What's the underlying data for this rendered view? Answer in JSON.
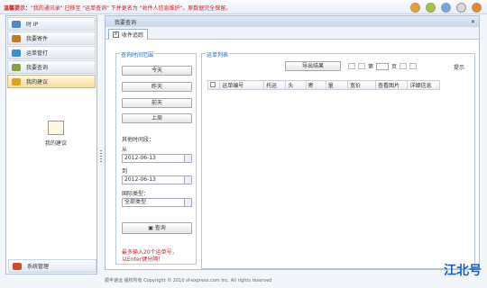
{
  "notice": {
    "prefix": "温馨提示：",
    "text": "\"我的通讯录\" 已移至 \"运单查询\" 下并更名为 \"收件人信息维护\"，原数据完全保留。"
  },
  "window_buttons": [
    "#f0a020",
    "#a5c92a",
    "#6fa8e0",
    "#d8d8d8",
    "#e98a19"
  ],
  "sidebar": {
    "items": [
      {
        "label": "时 IP",
        "icon": "monitor-icon",
        "color": "#4d87c9"
      },
      {
        "label": "我要寄件",
        "icon": "box-icon",
        "color": "#c77a2a"
      },
      {
        "label": "运单管打",
        "icon": "printer-icon",
        "color": "#3b8fd4"
      },
      {
        "label": "我要查询",
        "icon": "search-icon",
        "color": "#8aa03a"
      },
      {
        "label": "我的建议",
        "icon": "pencil-icon",
        "color": "#e0a020"
      }
    ],
    "active_index": 4,
    "body_item": {
      "label": "我的建议",
      "icon": "note-pencil-icon"
    },
    "system_item": {
      "label": "系统管理",
      "icon": "gear-icon"
    }
  },
  "content": {
    "header_title": "我要查询",
    "tab_label": "收件追踪",
    "time_panel": {
      "title": "查询时间范围",
      "buttons": [
        "今天",
        "昨天",
        "前天",
        "上周"
      ],
      "other_label": "其他时间段：",
      "from_label": "从",
      "from_value": "2012-06-13",
      "to_label": "到",
      "to_value": "2012-06-13",
      "type_label": "国际类型：",
      "type_value": "全部类型",
      "query_button": "查询",
      "tip_line1": "最多输入20个运单号，",
      "tip_line2": "以Enter键分隔！"
    },
    "list_panel": {
      "title": "运单列表",
      "export_button": "导出结果",
      "page_label": "第",
      "page_suffix": "页",
      "prompt_label": "提示",
      "columns": [
        "",
        "运单编号",
        "托运",
        "头",
        "寄",
        "量",
        "宽价",
        "查看图片",
        "详细信息"
      ]
    }
  },
  "footer": "顺丰速运  版权所有  Copyright © 2010 sf-express.com Inc. All rights reserved",
  "watermark": "江北号"
}
